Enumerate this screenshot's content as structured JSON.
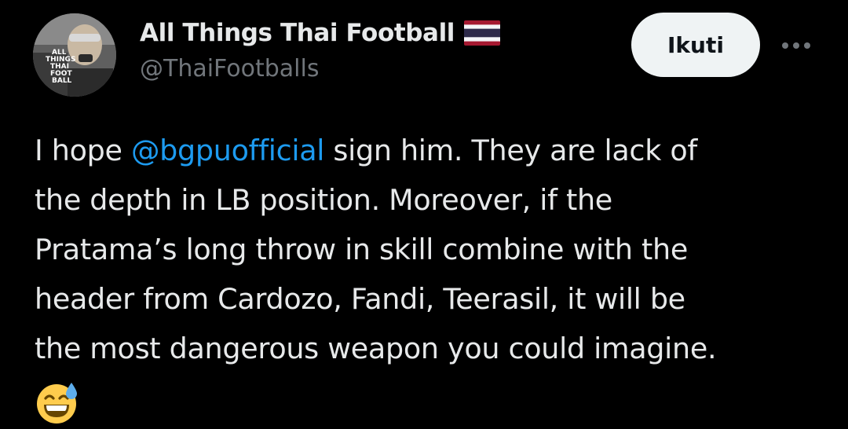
{
  "author": {
    "display_name": "All Things Thai Football",
    "handle": "@ThaiFootballs",
    "avatar_text": "ALL THINGS THAI FOOTBALL",
    "verified_flag": "thailand-flag-icon"
  },
  "actions": {
    "follow_label": "Ikuti",
    "more_icon": "more-icon"
  },
  "tweet": {
    "lines": [
      {
        "before": "I hope ",
        "mention": "@bgpuofficial",
        "after": " sign him. They are lack of"
      },
      {
        "text": "the depth in LB position. Moreover, if the"
      },
      {
        "text": "Pratama’s long throw in skill combine with the"
      },
      {
        "text": "header from Cardozo, Fandi, Teerasil, it will be"
      },
      {
        "text": "the most dangerous weapon you could imagine."
      }
    ],
    "emoji": "grinning-face-with-sweat-icon"
  },
  "colors": {
    "background": "#000000",
    "text": "#e7e9ea",
    "secondary": "#71767b",
    "link": "#1d9bf0",
    "button_bg": "#eff3f4"
  }
}
